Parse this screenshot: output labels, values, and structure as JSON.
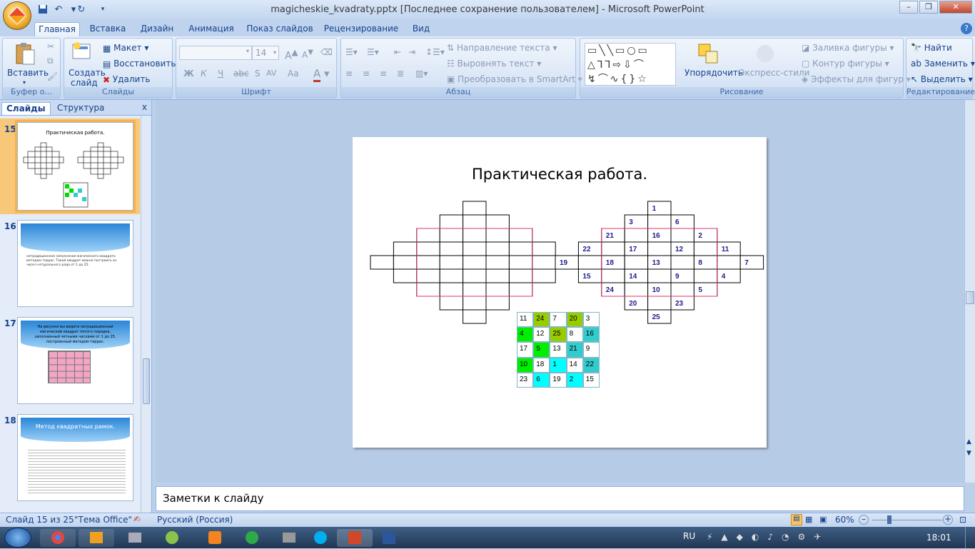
{
  "window": {
    "title": "magicheskie_kvadraty.pptx [Последнее сохранение пользователем] - Microsoft PowerPoint"
  },
  "tabs": [
    "Главная",
    "Вставка",
    "Дизайн",
    "Анимация",
    "Показ слайдов",
    "Рецензирование",
    "Вид"
  ],
  "ribbon": {
    "clipboard": {
      "paste": "Вставить",
      "label": "Буфер о..."
    },
    "slides": {
      "new_slide_1": "Создать",
      "new_slide_2": "слайд",
      "layout": "Макет",
      "reset": "Восстановить",
      "delete": "Удалить",
      "label": "Слайды"
    },
    "font": {
      "size": "14",
      "label": "Шрифт",
      "bold": "Ж",
      "italic": "К",
      "underline": "Ч",
      "strike": "abc",
      "spacing": "AV",
      "case": "Aa"
    },
    "paragraph": {
      "text_dir": "Направление текста",
      "align_text": "Выровнять текст",
      "smartart": "Преобразовать в SmartArt",
      "label": "Абзац"
    },
    "drawing": {
      "arrange": "Упорядочить",
      "styles": "Экспресс-стили",
      "fill": "Заливка фигуры",
      "outline": "Контур фигуры",
      "effects": "Эффекты для фигур",
      "label": "Рисование"
    },
    "editing": {
      "find": "Найти",
      "replace": "Заменить",
      "select": "Выделить",
      "label": "Редактирование"
    }
  },
  "panel": {
    "tab_slides": "Слайды",
    "tab_outline": "Структура",
    "close": "x"
  },
  "thumbnails": [
    {
      "num": "15",
      "title": "Практическая работа."
    },
    {
      "num": "16",
      "text": "нетрадиционное заполнение магического квадрата методом террас. Такой квадрат можно построить из чисел натурального ряда от 1 до 25."
    },
    {
      "num": "17",
      "text": "На рисунке вы видите нетрадиционный магический квадрат пятого порядка, заполненный четными числами от 1 до 25, построенный методом террас."
    },
    {
      "num": "18",
      "title": "Метод квадратных рамок."
    }
  ],
  "slide": {
    "title": "Практическая работа.",
    "numbers": [
      {
        "v": "1"
      },
      {
        "v": "6"
      },
      {
        "v": "2"
      },
      {
        "v": "11"
      },
      {
        "v": "7"
      },
      {
        "v": "3"
      },
      {
        "v": "16"
      },
      {
        "v": "12"
      },
      {
        "v": "8"
      },
      {
        "v": "4"
      },
      {
        "v": "21"
      },
      {
        "v": "17"
      },
      {
        "v": "13"
      },
      {
        "v": "9"
      },
      {
        "v": "5"
      },
      {
        "v": "22"
      },
      {
        "v": "18"
      },
      {
        "v": "14"
      },
      {
        "v": "10"
      },
      {
        "v": "23"
      },
      {
        "v": "19"
      },
      {
        "v": "15"
      },
      {
        "v": "24"
      },
      {
        "v": "20"
      },
      {
        "v": "25"
      }
    ],
    "magic_square": [
      [
        {
          "v": "11",
          "c": "#ffffff"
        },
        {
          "v": "24",
          "c": "#99cc00"
        },
        {
          "v": "7",
          "c": "#ffffff"
        },
        {
          "v": "20",
          "c": "#99cc00"
        },
        {
          "v": "3",
          "c": "#ffffff"
        }
      ],
      [
        {
          "v": "4",
          "c": "#00ee00"
        },
        {
          "v": "12",
          "c": "#ffffff"
        },
        {
          "v": "25",
          "c": "#99cc00"
        },
        {
          "v": "8",
          "c": "#ffffff"
        },
        {
          "v": "16",
          "c": "#33cccc"
        }
      ],
      [
        {
          "v": "17",
          "c": "#ffffff"
        },
        {
          "v": "5",
          "c": "#00ee00"
        },
        {
          "v": "13",
          "c": "#ffffff"
        },
        {
          "v": "21",
          "c": "#33cccc"
        },
        {
          "v": "9",
          "c": "#ffffff"
        }
      ],
      [
        {
          "v": "10",
          "c": "#00ee00"
        },
        {
          "v": "18",
          "c": "#ffffff"
        },
        {
          "v": "1",
          "c": "#00ffff"
        },
        {
          "v": "14",
          "c": "#ffffff"
        },
        {
          "v": "22",
          "c": "#33cccc"
        }
      ],
      [
        {
          "v": "23",
          "c": "#ffffff"
        },
        {
          "v": "6",
          "c": "#00ffff"
        },
        {
          "v": "19",
          "c": "#ffffff"
        },
        {
          "v": "2",
          "c": "#00ffff"
        },
        {
          "v": "15",
          "c": "#ffffff"
        }
      ]
    ]
  },
  "notes": {
    "placeholder": "Заметки к слайду"
  },
  "status": {
    "slide_of": "Слайд 15 из 25",
    "theme": "\"Тема Office\"",
    "language": "Русский (Россия)",
    "zoom": "60%"
  },
  "tray": {
    "lang": "RU",
    "time": "18:01"
  }
}
